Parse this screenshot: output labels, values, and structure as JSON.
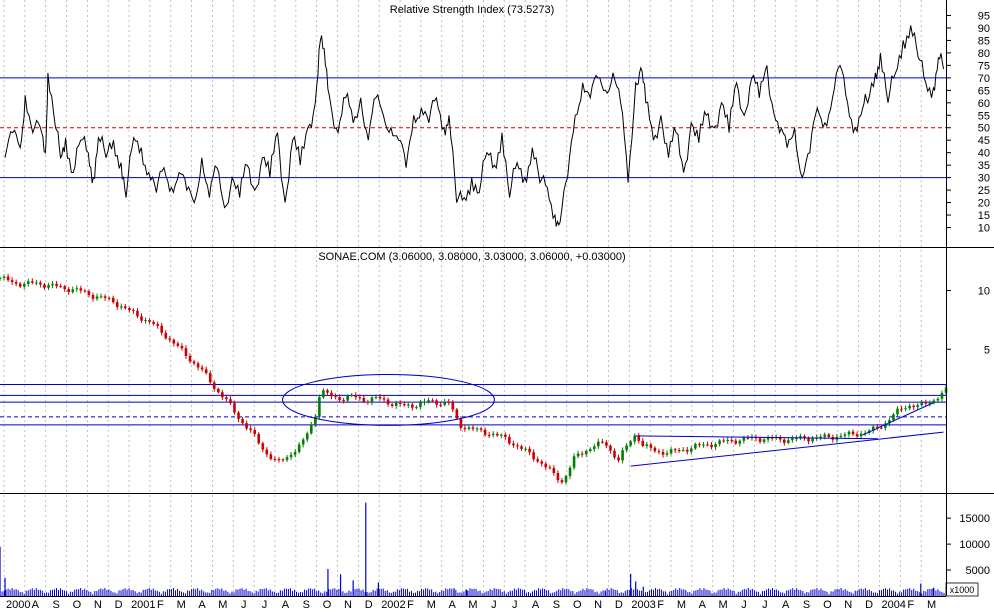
{
  "chart_data": [
    {
      "type": "line",
      "title": "Relative Strength Index (73.5273)",
      "ylim": [
        5,
        98
      ],
      "y_ticks": [
        10,
        15,
        20,
        25,
        30,
        35,
        40,
        45,
        50,
        55,
        60,
        65,
        70,
        75,
        80,
        85,
        90,
        95
      ],
      "reference_lines": [
        {
          "value": 70,
          "color": "#0000cc",
          "style": "solid"
        },
        {
          "value": 50,
          "color": "#cc0000",
          "style": "dashed"
        },
        {
          "value": 30,
          "color": "#0000cc",
          "style": "solid"
        }
      ],
      "x_range": [
        2000.5,
        2004.25
      ],
      "series": [
        {
          "color": "#000000",
          "points": [
            [
              2000.52,
              38
            ],
            [
              2000.55,
              48
            ],
            [
              2000.58,
              42
            ],
            [
              2000.6,
              63
            ],
            [
              2000.63,
              48
            ],
            [
              2000.66,
              50
            ],
            [
              2000.68,
              40
            ],
            [
              2000.69,
              72
            ],
            [
              2000.72,
              50
            ],
            [
              2000.74,
              38
            ],
            [
              2000.76,
              46
            ],
            [
              2000.79,
              32
            ],
            [
              2000.82,
              45
            ],
            [
              2000.85,
              40
            ],
            [
              2000.87,
              30
            ],
            [
              2000.89,
              46
            ],
            [
              2000.92,
              38
            ],
            [
              2000.95,
              45
            ],
            [
              2000.98,
              36
            ],
            [
              2001.0,
              22
            ],
            [
              2001.03,
              46
            ],
            [
              2001.06,
              42
            ],
            [
              2001.09,
              32
            ],
            [
              2001.12,
              24
            ],
            [
              2001.15,
              34
            ],
            [
              2001.18,
              26
            ],
            [
              2001.21,
              32
            ],
            [
              2001.24,
              25
            ],
            [
              2001.27,
              20
            ],
            [
              2001.3,
              38
            ],
            [
              2001.33,
              22
            ],
            [
              2001.36,
              34
            ],
            [
              2001.39,
              18
            ],
            [
              2001.42,
              30
            ],
            [
              2001.45,
              22
            ],
            [
              2001.48,
              35
            ],
            [
              2001.51,
              25
            ],
            [
              2001.54,
              38
            ],
            [
              2001.57,
              30
            ],
            [
              2001.6,
              48
            ],
            [
              2001.63,
              20
            ],
            [
              2001.66,
              45
            ],
            [
              2001.69,
              35
            ],
            [
              2001.72,
              50
            ],
            [
              2001.75,
              60
            ],
            [
              2001.77,
              85
            ],
            [
              2001.79,
              75
            ],
            [
              2001.81,
              60
            ],
            [
              2001.84,
              48
            ],
            [
              2001.87,
              62
            ],
            [
              2001.9,
              52
            ],
            [
              2001.93,
              62
            ],
            [
              2001.96,
              45
            ],
            [
              2001.99,
              62
            ],
            [
              2002.02,
              55
            ],
            [
              2002.05,
              50
            ],
            [
              2002.08,
              45
            ],
            [
              2002.11,
              34
            ],
            [
              2002.14,
              55
            ],
            [
              2002.17,
              58
            ],
            [
              2002.2,
              52
            ],
            [
              2002.23,
              62
            ],
            [
              2002.26,
              50
            ],
            [
              2002.28,
              55
            ],
            [
              2002.31,
              20
            ],
            [
              2002.34,
              22
            ],
            [
              2002.37,
              30
            ],
            [
              2002.4,
              24
            ],
            [
              2002.43,
              40
            ],
            [
              2002.46,
              35
            ],
            [
              2002.49,
              48
            ],
            [
              2002.52,
              22
            ],
            [
              2002.55,
              36
            ],
            [
              2002.58,
              30
            ],
            [
              2002.61,
              42
            ],
            [
              2002.64,
              28
            ],
            [
              2002.67,
              26
            ],
            [
              2002.7,
              15
            ],
            [
              2002.72,
              12
            ],
            [
              2002.75,
              30
            ],
            [
              2002.78,
              55
            ],
            [
              2002.81,
              68
            ],
            [
              2002.84,
              62
            ],
            [
              2002.87,
              70
            ],
            [
              2002.9,
              65
            ],
            [
              2002.93,
              72
            ],
            [
              2002.96,
              60
            ],
            [
              2002.99,
              28
            ],
            [
              2003.02,
              68
            ],
            [
              2003.04,
              74
            ],
            [
              2003.06,
              60
            ],
            [
              2003.09,
              45
            ],
            [
              2003.12,
              55
            ],
            [
              2003.15,
              38
            ],
            [
              2003.18,
              48
            ],
            [
              2003.21,
              32
            ],
            [
              2003.24,
              52
            ],
            [
              2003.27,
              44
            ],
            [
              2003.3,
              55
            ],
            [
              2003.33,
              50
            ],
            [
              2003.36,
              60
            ],
            [
              2003.39,
              48
            ],
            [
              2003.42,
              68
            ],
            [
              2003.45,
              55
            ],
            [
              2003.48,
              70
            ],
            [
              2003.51,
              62
            ],
            [
              2003.54,
              75
            ],
            [
              2003.56,
              60
            ],
            [
              2003.59,
              48
            ],
            [
              2003.62,
              42
            ],
            [
              2003.65,
              50
            ],
            [
              2003.68,
              30
            ],
            [
              2003.71,
              40
            ],
            [
              2003.74,
              58
            ],
            [
              2003.77,
              52
            ],
            [
              2003.8,
              62
            ],
            [
              2003.83,
              75
            ],
            [
              2003.86,
              60
            ],
            [
              2003.89,
              50
            ],
            [
              2003.92,
              58
            ],
            [
              2003.94,
              60
            ],
            [
              2003.97,
              72
            ],
            [
              2003.99,
              80
            ],
            [
              2004.02,
              60
            ],
            [
              2004.05,
              72
            ],
            [
              2004.08,
              85
            ],
            [
              2004.11,
              91
            ],
            [
              2004.14,
              78
            ],
            [
              2004.17,
              68
            ],
            [
              2004.2,
              66
            ],
            [
              2004.22,
              78
            ],
            [
              2004.24,
              73.5
            ]
          ]
        }
      ]
    },
    {
      "type": "candlestick",
      "title": "SONAE.COM (3.06000, 3.08000, 3.03000, 3.06000, +0.03000)",
      "y_scale": "log",
      "ylim": [
        0.95,
        14
      ],
      "y_ticks": [
        5,
        10
      ],
      "colors": {
        "up": "#008000",
        "down": "#cc0000",
        "trendline": "#0000cc"
      },
      "x_range": [
        2000.5,
        2004.25
      ],
      "price_path": [
        [
          2000.5,
          11.6
        ],
        [
          2000.55,
          11.0
        ],
        [
          2000.6,
          10.8
        ],
        [
          2000.65,
          10.9
        ],
        [
          2000.7,
          10.6
        ],
        [
          2000.75,
          10.3
        ],
        [
          2000.8,
          10.1
        ],
        [
          2000.85,
          9.6
        ],
        [
          2000.9,
          9.2
        ],
        [
          2000.95,
          8.8
        ],
        [
          2001.0,
          8.0
        ],
        [
          2001.05,
          7.4
        ],
        [
          2001.1,
          6.8
        ],
        [
          2001.15,
          6.0
        ],
        [
          2001.2,
          5.2
        ],
        [
          2001.25,
          4.5
        ],
        [
          2001.3,
          3.9
        ],
        [
          2001.35,
          3.2
        ],
        [
          2001.4,
          2.7
        ],
        [
          2001.45,
          2.2
        ],
        [
          2001.5,
          1.85
        ],
        [
          2001.55,
          1.5
        ],
        [
          2001.6,
          1.3
        ],
        [
          2001.65,
          1.45
        ],
        [
          2001.7,
          1.65
        ],
        [
          2001.75,
          2.3
        ],
        [
          2001.77,
          3.1
        ],
        [
          2001.8,
          2.9
        ],
        [
          2001.85,
          2.8
        ],
        [
          2001.9,
          2.85
        ],
        [
          2001.95,
          2.75
        ],
        [
          2002.0,
          2.8
        ],
        [
          2002.05,
          2.65
        ],
        [
          2002.1,
          2.55
        ],
        [
          2002.15,
          2.6
        ],
        [
          2002.2,
          2.7
        ],
        [
          2002.28,
          2.65
        ],
        [
          2002.32,
          2.05
        ],
        [
          2002.4,
          1.9
        ],
        [
          2002.45,
          1.85
        ],
        [
          2002.5,
          1.75
        ],
        [
          2002.55,
          1.6
        ],
        [
          2002.6,
          1.45
        ],
        [
          2002.65,
          1.3
        ],
        [
          2002.7,
          1.12
        ],
        [
          2002.73,
          1.05
        ],
        [
          2002.78,
          1.4
        ],
        [
          2002.85,
          1.6
        ],
        [
          2002.9,
          1.65
        ],
        [
          2002.95,
          1.35
        ],
        [
          2003.0,
          1.7
        ],
        [
          2003.02,
          1.85
        ],
        [
          2003.05,
          1.6
        ],
        [
          2003.1,
          1.5
        ],
        [
          2003.15,
          1.48
        ],
        [
          2003.2,
          1.52
        ],
        [
          2003.25,
          1.58
        ],
        [
          2003.3,
          1.62
        ],
        [
          2003.4,
          1.7
        ],
        [
          2003.5,
          1.75
        ],
        [
          2003.6,
          1.72
        ],
        [
          2003.7,
          1.75
        ],
        [
          2003.8,
          1.78
        ],
        [
          2003.9,
          1.85
        ],
        [
          2003.95,
          1.9
        ],
        [
          2004.0,
          2.05
        ],
        [
          2004.05,
          2.35
        ],
        [
          2004.1,
          2.6
        ],
        [
          2004.15,
          2.55
        ],
        [
          2004.2,
          2.75
        ],
        [
          2004.25,
          3.06
        ]
      ],
      "horizontal_lines": [
        {
          "value": 3.3,
          "color": "#0000cc",
          "style": "solid"
        },
        {
          "value": 2.9,
          "color": "#0000cc",
          "style": "solid"
        },
        {
          "value": 2.68,
          "color": "#0000cc",
          "style": "solid"
        },
        {
          "value": 2.25,
          "color": "#0000cc",
          "style": "dashed"
        },
        {
          "value": 2.05,
          "color": "#0000cc",
          "style": "solid"
        }
      ],
      "trendlines": [
        {
          "from": [
            2003.0,
            1.26
          ],
          "to": [
            2004.24,
            1.88
          ]
        },
        {
          "from": [
            2003.02,
            1.8
          ],
          "to": [
            2003.98,
            1.74
          ]
        },
        {
          "from": [
            2003.92,
            1.82
          ],
          "to": [
            2004.2,
            2.66
          ]
        }
      ],
      "ellipse": {
        "center": [
          2002.04,
          2.75
        ],
        "rx_years": 0.42,
        "ry_log_ratio": 1.35
      }
    },
    {
      "type": "bar",
      "title": "",
      "unit_label": "x1000",
      "ylim": [
        0,
        18500
      ],
      "y_ticks": [
        5000,
        10000,
        15000
      ],
      "color": "#0000cc",
      "spikes": [
        [
          2000.5,
          9500
        ],
        [
          2000.52,
          3500
        ],
        [
          2001.8,
          5200
        ],
        [
          2001.85,
          4200
        ],
        [
          2001.9,
          3000
        ],
        [
          2001.95,
          18000
        ],
        [
          2002.0,
          2600
        ],
        [
          2002.3,
          1500
        ],
        [
          2002.35,
          1200
        ],
        [
          2002.9,
          900
        ],
        [
          2003.0,
          4300
        ],
        [
          2003.02,
          2800
        ],
        [
          2003.05,
          1800
        ],
        [
          2004.15,
          2400
        ],
        [
          2004.2,
          1600
        ]
      ],
      "x_labels": [
        "2000",
        "A",
        "S",
        "O",
        "N",
        "D",
        "2001",
        "F",
        "M",
        "A",
        "M",
        "J",
        "J",
        "A",
        "S",
        "O",
        "N",
        "D",
        "2002",
        "F",
        "M",
        "A",
        "M",
        "J",
        "J",
        "A",
        "S",
        "O",
        "N",
        "D",
        "2003",
        "F",
        "M",
        "A",
        "M",
        "J",
        "J",
        "A",
        "S",
        "O",
        "N",
        "D",
        "2004",
        "F",
        "M"
      ]
    }
  ]
}
